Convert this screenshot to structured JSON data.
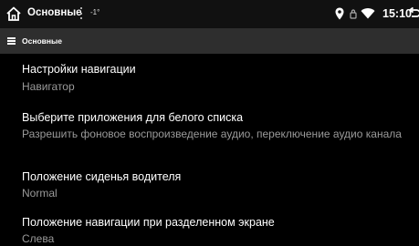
{
  "statusbar": {
    "title": "Основные",
    "temperature": "-1°",
    "time": "15:10",
    "icons": [
      "home-icon",
      "more-vert-icon",
      "location-icon",
      "wifi-lock-icon",
      "wifi-icon",
      "back-icon"
    ]
  },
  "subbar": {
    "title": "Основные"
  },
  "items": [
    {
      "title": "Настройки навигации",
      "subtitle": "Навигатор"
    },
    {
      "title": "Выберите приложения для белого списка",
      "subtitle": "Разрешить фоновое воспроизведение аудио, переключение аудио канала"
    },
    {
      "title": "Положение сиденья водителя",
      "subtitle": "Normal"
    },
    {
      "title": "Положение навигации при разделенном экране",
      "subtitle": "Слева"
    }
  ]
}
